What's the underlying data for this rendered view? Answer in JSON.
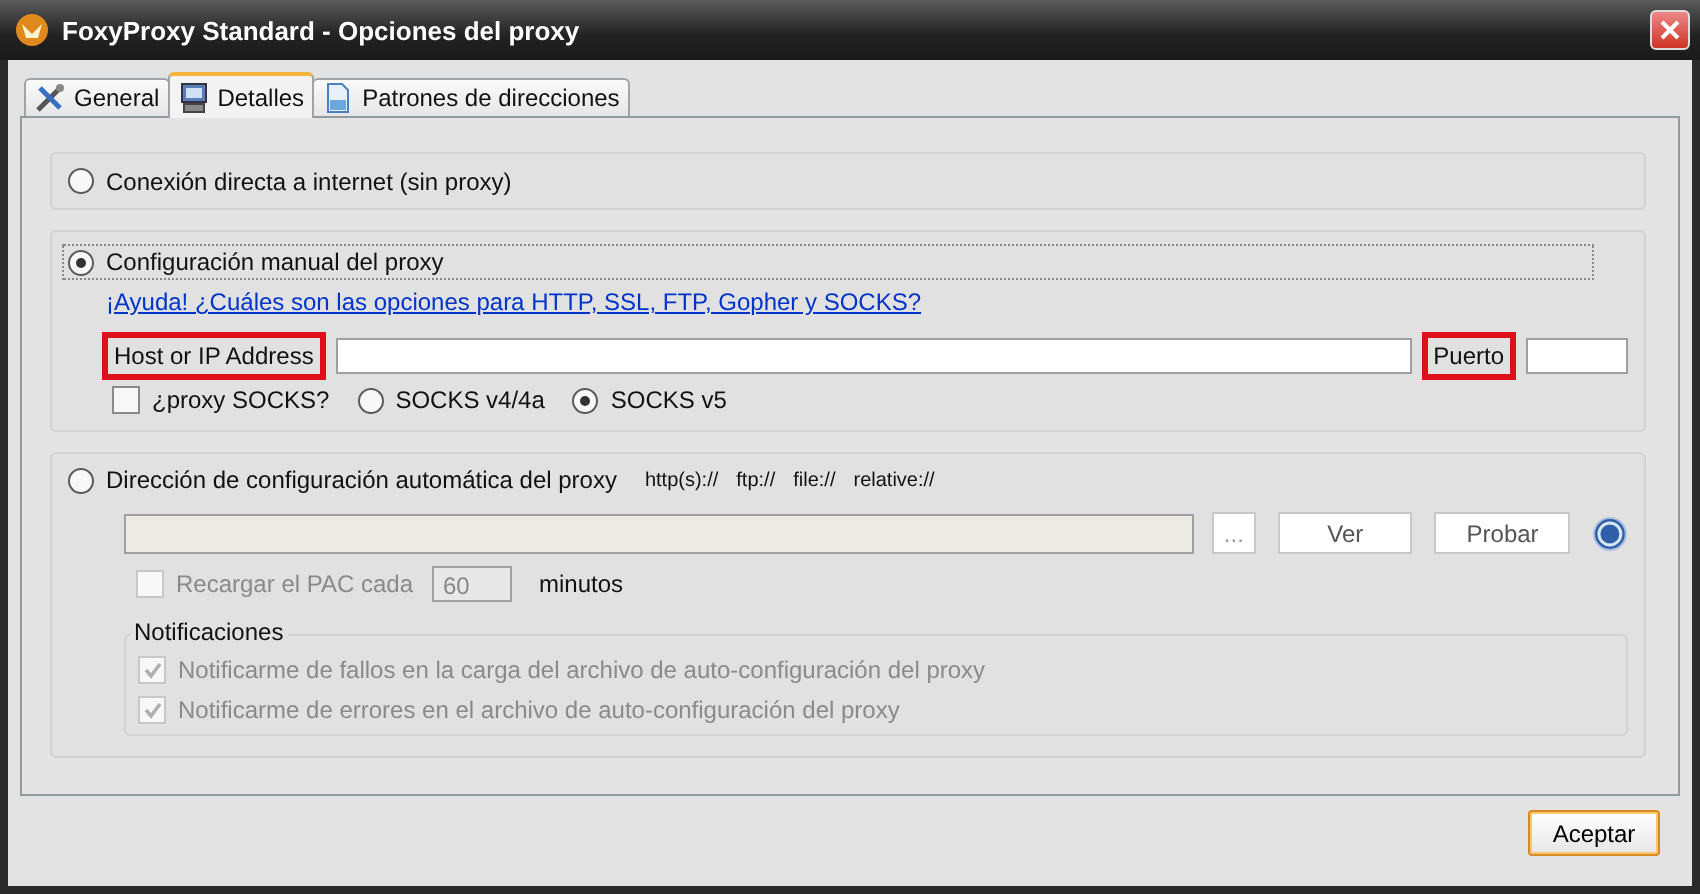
{
  "window": {
    "title": "FoxyProxy Standard - Opciones del proxy"
  },
  "tabs": [
    {
      "label": "General",
      "selected": false
    },
    {
      "label": "Detalles",
      "selected": true
    },
    {
      "label": "Patrones de direcciones",
      "selected": false
    }
  ],
  "direct": {
    "label": "Conexión directa a internet (sin proxy)",
    "selected": false
  },
  "manual": {
    "label": "Configuración manual del proxy",
    "selected": true,
    "help_link": "¡Ayuda! ¿Cuáles son las opciones para HTTP, SSL, FTP, Gopher y SOCKS?",
    "host": {
      "label": "Host or IP Address",
      "highlighted": true
    },
    "port": {
      "label": "Puerto",
      "highlighted": true
    },
    "socks_proxy": {
      "label": "¿proxy SOCKS?",
      "checked": false
    },
    "socks_versions": [
      {
        "label": "SOCKS v4/4a",
        "selected": false
      },
      {
        "label": "SOCKS v5",
        "selected": true
      }
    ]
  },
  "auto": {
    "label": "Dirección de configuración automática del proxy",
    "selected": false,
    "schemes": [
      "http(s)://",
      "ftp://",
      "file://",
      "relative://"
    ],
    "buttons": [
      "...",
      "Ver",
      "Probar"
    ],
    "reload": {
      "label": "Recargar el PAC cada",
      "checked": false,
      "disabled": true
    },
    "interval": "60",
    "interval_unit": "minutos",
    "notifications": {
      "title": "Notificaciones",
      "items": [
        {
          "label": "Notificarme de fallos en la carga del archivo de auto-configuración del proxy",
          "checked": true,
          "disabled": true
        },
        {
          "label": "Notificarme de errores en el archivo de auto-configuración del proxy",
          "checked": true,
          "disabled": true
        }
      ]
    }
  },
  "buttons": [
    "Aceptar"
  ]
}
